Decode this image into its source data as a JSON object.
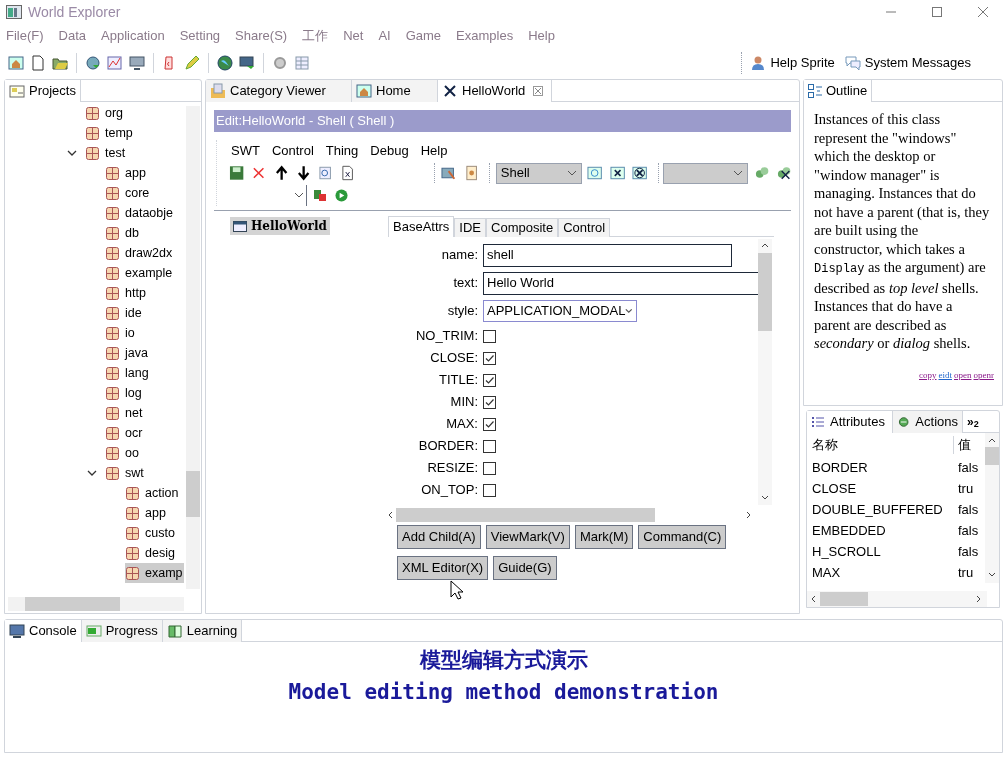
{
  "window": {
    "title": "World Explorer"
  },
  "menu": [
    "File(F)",
    "Data",
    "Application",
    "Setting",
    "Share(S)",
    "工作",
    "Net",
    "AI",
    "Game",
    "Examples",
    "Help"
  ],
  "toolbar_right": [
    "Help Sprite",
    "System Messages"
  ],
  "projects": {
    "tabs": [
      {
        "label": "Projects",
        "selected": true
      }
    ],
    "tree": [
      {
        "label": "org"
      },
      {
        "label": "temp"
      },
      {
        "label": "test",
        "expanded": true,
        "children": [
          {
            "label": "app"
          },
          {
            "label": "core"
          },
          {
            "label": "dataobje"
          },
          {
            "label": "db"
          },
          {
            "label": "draw2dx"
          },
          {
            "label": "example"
          },
          {
            "label": "http"
          },
          {
            "label": "ide"
          },
          {
            "label": "io"
          },
          {
            "label": "java"
          },
          {
            "label": "lang"
          },
          {
            "label": "log"
          },
          {
            "label": "net"
          },
          {
            "label": "ocr"
          },
          {
            "label": "oo"
          },
          {
            "label": "swt",
            "expanded": true,
            "children": [
              {
                "label": "action",
                "selected": false
              },
              {
                "label": "app",
                "selected": false
              },
              {
                "label": "custo",
                "selected": false
              },
              {
                "label": "desig",
                "selected": false
              },
              {
                "label": "examp",
                "selected": true
              }
            ]
          }
        ]
      }
    ]
  },
  "editor": {
    "tabs": [
      {
        "label": "Category Viewer",
        "selected": false
      },
      {
        "label": "Home",
        "selected": false
      },
      {
        "label": "HelloWorld",
        "selected": true
      }
    ],
    "header": "Edit:HelloWorld - Shell ( Shell )",
    "menu": [
      "SWT",
      "Control",
      "Thing",
      "Debug",
      "Help"
    ],
    "type_combo": "Shell",
    "node": "HelloWorld",
    "prop_tabs": [
      {
        "label": "BaseAttrs",
        "selected": true
      },
      {
        "label": "IDE",
        "selected": false
      },
      {
        "label": "Composite",
        "selected": false
      },
      {
        "label": "Control",
        "selected": false
      }
    ],
    "fields": [
      {
        "kind": "text",
        "label": "name:",
        "value": "shell"
      },
      {
        "kind": "text",
        "label": "text:",
        "value": "Hello World"
      },
      {
        "kind": "select",
        "label": "style:",
        "value": "APPLICATION_MODAL"
      },
      {
        "kind": "checkbox",
        "label": "NO_TRIM:",
        "checked": false
      },
      {
        "kind": "checkbox",
        "label": "CLOSE:",
        "checked": true
      },
      {
        "kind": "checkbox",
        "label": "TITLE:",
        "checked": true
      },
      {
        "kind": "checkbox",
        "label": "MIN:",
        "checked": true
      },
      {
        "kind": "checkbox",
        "label": "MAX:",
        "checked": true
      },
      {
        "kind": "checkbox",
        "label": "BORDER:",
        "checked": false
      },
      {
        "kind": "checkbox",
        "label": "RESIZE:",
        "checked": false
      },
      {
        "kind": "checkbox",
        "label": "ON_TOP:",
        "checked": false
      }
    ],
    "buttons": [
      [
        "Add Child(A)",
        "ViewMark(V)",
        "Mark(M)",
        "Command(C)"
      ],
      [
        "XML Editor(X)",
        "Guide(G)"
      ]
    ]
  },
  "outline": {
    "tab": "Outline",
    "description": [
      {
        "kind": "plain",
        "text": "Instances of this class represent the \"windows\" which the desktop or \"window manager\" is managing. Instances that do not have a parent (that is, they are built using the constructor, which takes a "
      },
      {
        "kind": "code",
        "text": "Display"
      },
      {
        "kind": "plain",
        "text": " as the argument) are described as "
      },
      {
        "kind": "italic",
        "text": "top level"
      },
      {
        "kind": "plain",
        "text": " shells. Instances that do have a parent are described as "
      },
      {
        "kind": "italic",
        "text": "secondary"
      },
      {
        "kind": "plain",
        "text": " or "
      },
      {
        "kind": "italic",
        "text": "dialog"
      },
      {
        "kind": "plain",
        "text": " shells."
      }
    ],
    "links": [
      "copy",
      "eidt",
      "open",
      "openr"
    ]
  },
  "attributes": {
    "tabs": [
      {
        "label": "Attributes",
        "selected": true
      },
      {
        "label": "Actions",
        "selected": false
      }
    ],
    "more_tabs": "»$_{2}$",
    "columns": [
      "名称",
      "值"
    ],
    "rows": [
      {
        "name": "BORDER",
        "value": "fals"
      },
      {
        "name": "CLOSE",
        "value": "tru"
      },
      {
        "name": "DOUBLE_BUFFERED",
        "value": "fals"
      },
      {
        "name": "EMBEDDED",
        "value": "fals"
      },
      {
        "name": "H_SCROLL",
        "value": "fals"
      },
      {
        "name": "MAX",
        "value": "tru"
      }
    ]
  },
  "console": {
    "tabs": [
      {
        "label": "Console",
        "selected": true
      },
      {
        "label": "Progress",
        "selected": false
      },
      {
        "label": "Learning",
        "selected": false
      }
    ],
    "caption": [
      "模型编辑方式演示",
      "Model editing method demonstration"
    ]
  }
}
